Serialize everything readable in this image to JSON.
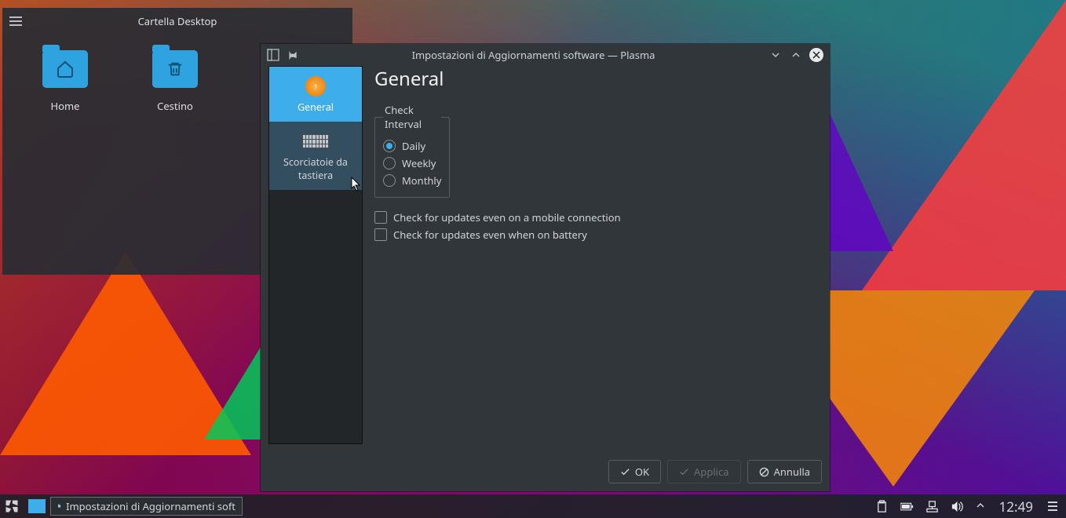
{
  "desktop_widget": {
    "title": "Cartella Desktop",
    "icons": [
      {
        "label": "Home",
        "glyph": "home"
      },
      {
        "label": "Cestino",
        "glyph": "trash"
      }
    ]
  },
  "dialog": {
    "window_title": "Impostazioni di Aggiornamenti software — Plasma",
    "sidebar": [
      {
        "label": "General",
        "active": true
      },
      {
        "label": "Scorciatoie da tastiera",
        "active": false
      }
    ],
    "page_title": "General",
    "interval_group": {
      "legend": "Check Interval",
      "options": [
        {
          "label": "Daily",
          "checked": true
        },
        {
          "label": "Weekly",
          "checked": false
        },
        {
          "label": "Monthly",
          "checked": false
        }
      ]
    },
    "checkboxes": [
      {
        "label": "Check for updates even on a mobile connection",
        "checked": false
      },
      {
        "label": "Check for updates even when on battery",
        "checked": false
      }
    ],
    "buttons": {
      "ok": "OK",
      "apply": "Applica",
      "cancel": "Annulla"
    }
  },
  "taskbar": {
    "task_label": "Impostazioni di Aggiornamenti soft",
    "clock": "12:49"
  }
}
